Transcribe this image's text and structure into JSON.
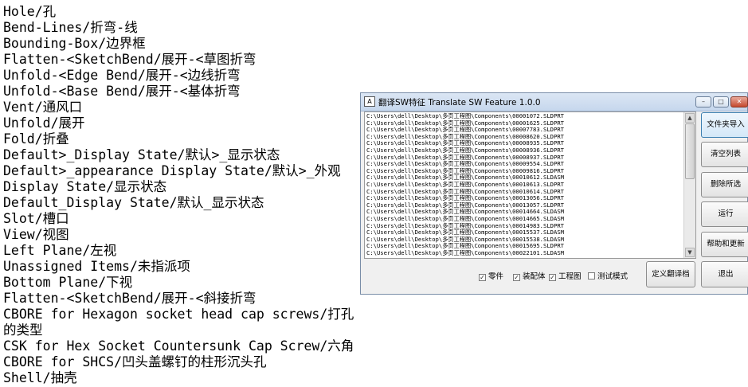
{
  "document": {
    "lines": [
      "Hole/孔",
      "Bend-Lines/折弯-线",
      "Bounding-Box/边界框",
      "Flatten-<SketchBend/展开-<草图折弯",
      "Unfold-<Edge Bend/展开-<边线折弯",
      "Unfold-<Base Bend/展开-<基体折弯",
      "Vent/通风口",
      "Unfold/展开",
      "Fold/折叠",
      "Default>_Display State/默认>_显示状态",
      "Default>_appearance Display State/默认>_外观",
      "Display State/显示状态",
      "Default_Display State/默认_显示状态",
      "Slot/槽口",
      "View/视图",
      "Left Plane/左视",
      "Unassigned Items/未指派项",
      "Bottom Plane/下视",
      "Flatten-<SketchBend/展开-<斜接折弯",
      "CBORE for Hexagon socket head cap screws/打孔",
      "的类型",
      "CSK for Hex Socket Countersunk Cap Screw/六角",
      "CBORE for SHCS/凹头盖螺钉的柱形沉头孔",
      "Shell/抽壳"
    ]
  },
  "window": {
    "title": "翻译SW特征 Translate SW Feature 1.0.0",
    "icon_glyph": "A",
    "controls": {
      "minimize": "–",
      "maximize": "□",
      "close": "✕"
    }
  },
  "file_list": [
    "C:\\Users\\dell\\Desktop\\多页工程图\\Components\\00001072.SLDPRT",
    "C:\\Users\\dell\\Desktop\\多页工程图\\Components\\00001625.SLDPRT",
    "C:\\Users\\dell\\Desktop\\多页工程图\\Components\\00007783.SLDPRT",
    "C:\\Users\\dell\\Desktop\\多页工程图\\Components\\00008620.SLDPRT",
    "C:\\Users\\dell\\Desktop\\多页工程图\\Components\\00008935.SLDPRT",
    "C:\\Users\\dell\\Desktop\\多页工程图\\Components\\00008936.SLDPRT",
    "C:\\Users\\dell\\Desktop\\多页工程图\\Components\\00008937.SLDPRT",
    "C:\\Users\\dell\\Desktop\\多页工程图\\Components\\00009554.SLDPRT",
    "C:\\Users\\dell\\Desktop\\多页工程图\\Components\\00009816.SLDPRT",
    "C:\\Users\\dell\\Desktop\\多页工程图\\Components\\00010612.SLDASM",
    "C:\\Users\\dell\\Desktop\\多页工程图\\Components\\00010613.SLDPRT",
    "C:\\Users\\dell\\Desktop\\多页工程图\\Components\\00010614.SLDPRT",
    "C:\\Users\\dell\\Desktop\\多页工程图\\Components\\00013056.SLDPRT",
    "C:\\Users\\dell\\Desktop\\多页工程图\\Components\\00013057.SLDPRT",
    "C:\\Users\\dell\\Desktop\\多页工程图\\Components\\00014664.SLDASM",
    "C:\\Users\\dell\\Desktop\\多页工程图\\Components\\00014665.SLDASM",
    "C:\\Users\\dell\\Desktop\\多页工程图\\Components\\00014983.SLDPRT",
    "C:\\Users\\dell\\Desktop\\多页工程图\\Components\\00015537.SLDASM",
    "C:\\Users\\dell\\Desktop\\多页工程图\\Components\\00015538.SLDASM",
    "C:\\Users\\dell\\Desktop\\多页工程图\\Components\\00015695.SLDPRT",
    "C:\\Users\\dell\\Desktop\\多页工程图\\Components\\00022101.SLDASM"
  ],
  "buttons": {
    "folder_import": "文件夹导入",
    "clear_list": "清空列表",
    "delete_selected": "删除所选",
    "run": "运行",
    "help_update": "帮助和更新",
    "custom_translate": "定义翻译档",
    "exit": "退出"
  },
  "checkboxes": [
    {
      "label": "零件",
      "checked": true
    },
    {
      "label": "装配体",
      "checked": true
    },
    {
      "label": "工程图",
      "checked": true
    },
    {
      "label": "测试模式",
      "checked": false
    }
  ]
}
